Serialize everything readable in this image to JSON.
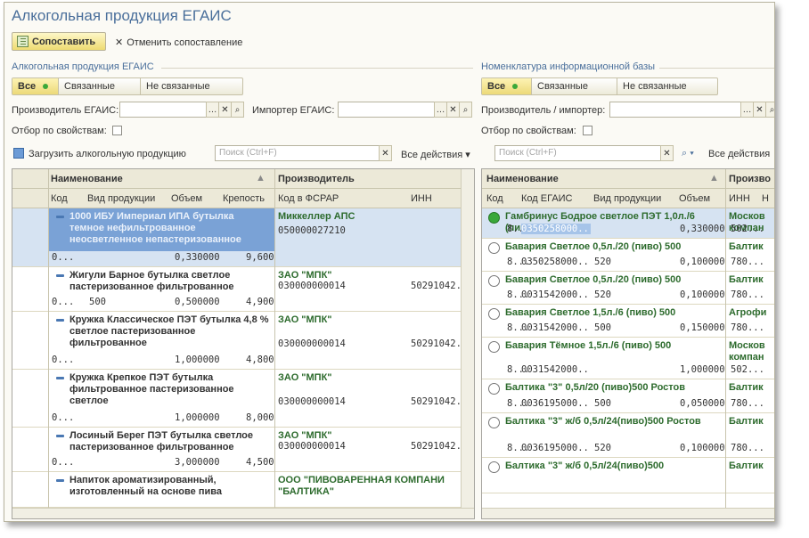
{
  "window_title": "Алкогольная продукция ЕГАИС",
  "toolbar": {
    "match_label": "Сопоставить",
    "unmatch_label": "Отменить сопоставление"
  },
  "left": {
    "section": "Алкогольная продукция ЕГАИС",
    "filters": [
      "Все",
      "Связанные",
      "Не связанные"
    ],
    "producer_label": "Производитель ЕГАИС:",
    "importer_label": "Импортер ЕГАИС:",
    "by_props_label": "Отбор по свойствам:",
    "load_label": "Загрузить алкогольную продукцию",
    "search_placeholder": "Поиск (Ctrl+F)",
    "all_actions": "Все действия ▾",
    "head_name": "Наименование",
    "head_producer": "Производитель",
    "col_code": "Код",
    "col_kind": "Вид продукции",
    "col_volume": "Объем",
    "col_strength": "Крепость",
    "col_fsrar": "Код в ФСРАР",
    "col_inn": "ИНН",
    "rows": [
      {
        "name": "1000 ИБУ Империал ИПА бутылка темное нефильтрованное неосветленное непастеризованное",
        "code": "0...",
        "kind": "",
        "volume": "0,330000",
        "strength": "9,600",
        "producer": "Миккеллер АПС",
        "fsrar": "050000027210",
        "inn": ""
      },
      {
        "name": "Жигули Барное бутылка светлое пастеризованное фильтрованное",
        "code": "0...",
        "kind": "500",
        "volume": "0,500000",
        "strength": "4,900",
        "producer": "ЗАО \"МПК\"",
        "fsrar": "030000000014",
        "inn": "50291042..."
      },
      {
        "name": "Кружка Классическое ПЭТ бутылка 4,8 % светлое пастеризованное фильтрованное",
        "code": "0...",
        "kind": "",
        "volume": "1,000000",
        "strength": "4,800",
        "producer": "ЗАО \"МПК\"",
        "fsrar": "030000000014",
        "inn": "50291042..."
      },
      {
        "name": "Кружка Крепкое ПЭТ бутылка фильтрованное пастеризованное светлое",
        "code": "0...",
        "kind": "",
        "volume": "1,000000",
        "strength": "8,000",
        "producer": "ЗАО \"МПК\"",
        "fsrar": "030000000014",
        "inn": "50291042..."
      },
      {
        "name": "Лосиный Берег ПЭТ бутылка светлое пастеризованное фильтрованное",
        "code": "0...",
        "kind": "",
        "volume": "3,000000",
        "strength": "4,500",
        "producer": "ЗАО \"МПК\"",
        "fsrar": "030000000014",
        "inn": "50291042..."
      },
      {
        "name": "Напиток ароматизированный, изготовленный на основе пива",
        "code": "",
        "kind": "",
        "volume": "",
        "strength": "",
        "producer": "ООО \"ПИВОВАРЕННАЯ КОМПАНИ \"БАЛТИКА\"",
        "fsrar": "",
        "inn": ""
      }
    ]
  },
  "right": {
    "section": "Номенклатура информационной базы",
    "filters": [
      "Все",
      "Связанные",
      "Не связанные"
    ],
    "producer_label": "Производитель / импортер:",
    "by_props_label": "Отбор по свойствам:",
    "search_placeholder": "Поиск (Ctrl+F)",
    "all_actions": "Все действия",
    "head_name": "Наименование",
    "head_producer": "Произво",
    "col_code": "Код",
    "col_egais": "Код ЕГАИС",
    "col_kind": "Вид продукции",
    "col_volume": "Объем",
    "col_inn": "ИНН",
    "col_extra": "Н",
    "rows": [
      {
        "name": "Гамбринус Бодрое светлое ПЭТ 1,0л./6 (пиво) 500",
        "code": "8...",
        "egais": "0350258000...",
        "kind": "",
        "volume": "0,330000",
        "producer": "Москов компан",
        "inn": "502...",
        "matched": true
      },
      {
        "name": "Бавария Светлое 0,5л./20 (пиво) 500",
        "code": "8...",
        "egais": "0350258000...",
        "kind": "520",
        "volume": "0,100000",
        "producer": "Балтик",
        "inn": "780...",
        "matched": false
      },
      {
        "name": "Бавария Светлое 0,5л./20 (пиво) 500",
        "code": "8...",
        "egais": "0031542000...",
        "kind": "520",
        "volume": "0,100000",
        "producer": "Балтик",
        "inn": "780...",
        "matched": false
      },
      {
        "name": "Бавария Светлое 1,5л./6 (пиво) 500",
        "code": "8...",
        "egais": "0031542000...",
        "kind": "500",
        "volume": "0,150000",
        "producer": "Агрофи",
        "inn": "780...",
        "matched": false
      },
      {
        "name": "Бавария Тёмное 1,5л./6 (пиво) 500",
        "code": "8...",
        "egais": "0031542000...",
        "kind": "",
        "volume": "1,000000",
        "producer": "Москов компан",
        "inn": "502...",
        "matched": false
      },
      {
        "name": "Балтика \"3\" 0,5л/20 (пиво)500 Ростов",
        "code": "8...",
        "egais": "0036195000...",
        "kind": "500",
        "volume": "0,050000",
        "producer": "Балтик",
        "inn": "780...",
        "matched": false
      },
      {
        "name": "Балтика \"3\" ж/б 0,5л/24(пиво)500 Ростов",
        "code": "8...",
        "egais": "0036195000...",
        "kind": "520",
        "volume": "0,100000",
        "producer": "Балтик",
        "inn": "780...",
        "matched": false
      },
      {
        "name": "Балтика \"3\" ж/б 0,5л/24(пиво)500",
        "code": "",
        "egais": "",
        "kind": "",
        "volume": "",
        "producer": "Балтик",
        "inn": "",
        "matched": false
      }
    ]
  },
  "colors": {
    "accent": "#4a6f9b",
    "selection": "#a6c4e9",
    "matched": "#3aa83a",
    "button": "#f4e28a"
  }
}
